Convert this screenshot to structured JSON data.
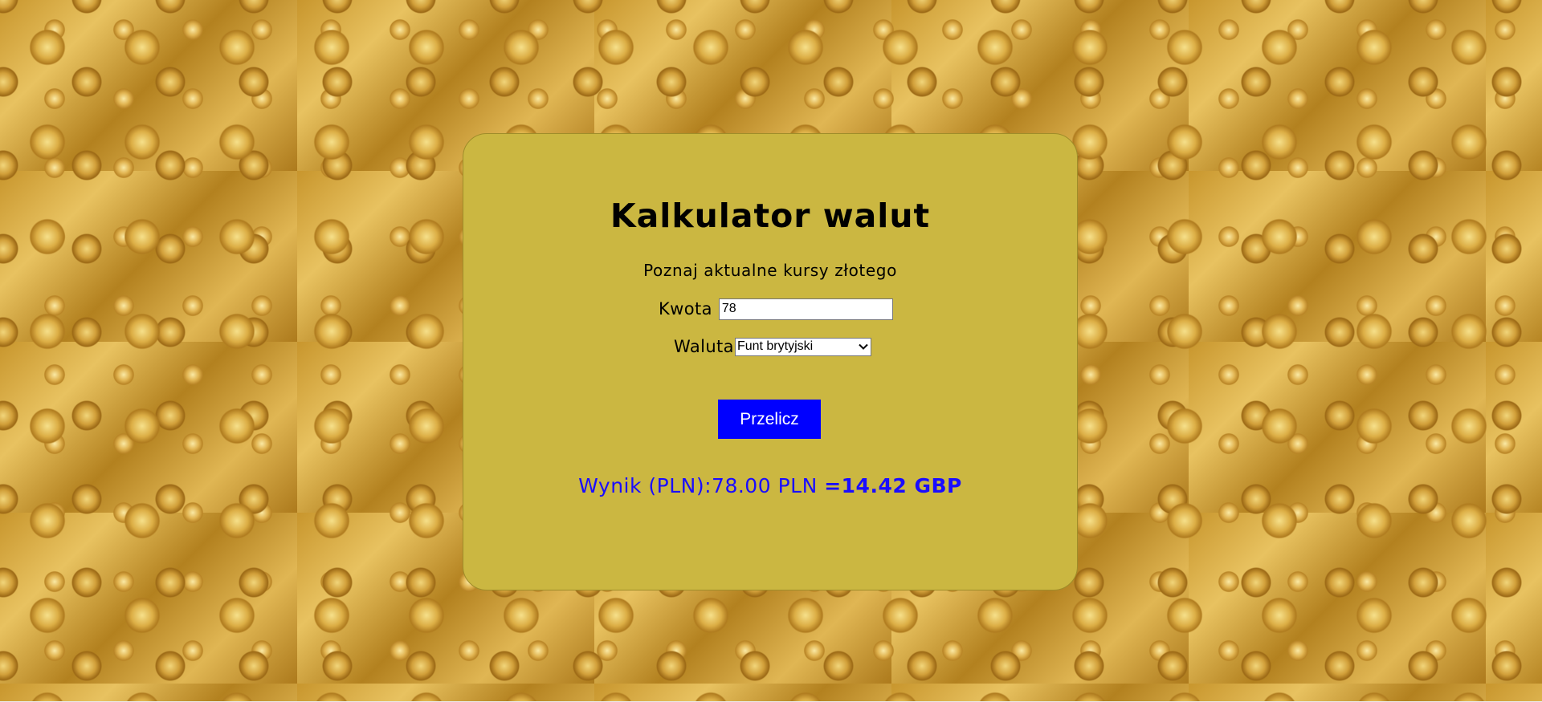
{
  "header": {
    "title": "Kalkulator walut",
    "subtitle": "Poznaj aktualne kursy złotego"
  },
  "form": {
    "amount_label": "Kwota",
    "amount_value": "78",
    "currency_label": "Waluta",
    "currency_selected": "Funt brytyjski",
    "convert_button": "Przelicz"
  },
  "result": {
    "prefix": "Wynik (PLN):78.00 PLN ",
    "converted": "=14.42  GBP"
  },
  "colors": {
    "card_background": "#cbb741",
    "button_background": "#0000ff",
    "result_text": "#1a0dff"
  },
  "icons": {
    "select_arrow": "chevron-down-icon",
    "background": "gold-coins-wallpaper"
  }
}
